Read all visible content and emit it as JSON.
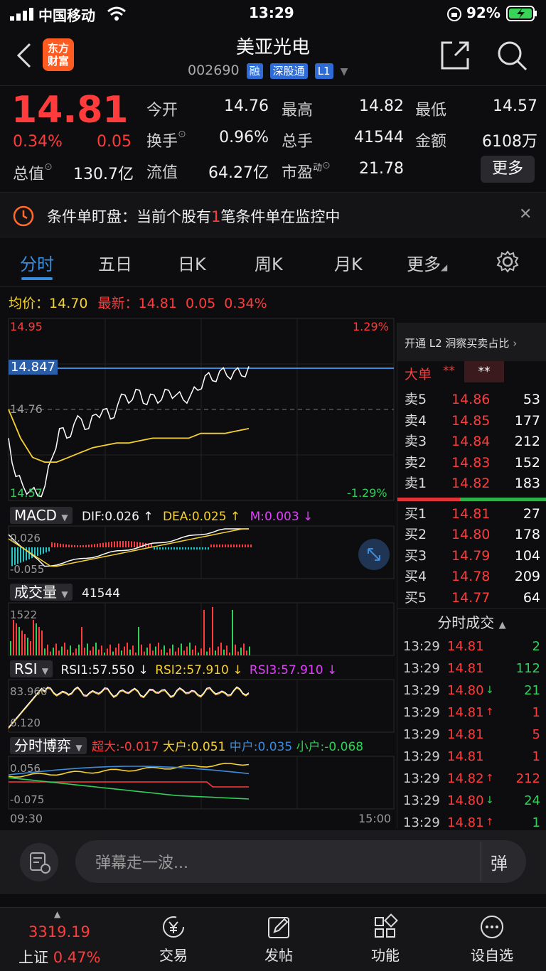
{
  "status_bar": {
    "carrier": "中国移动",
    "time": "13:29",
    "battery": "92%"
  },
  "header": {
    "logo_line1": "东方",
    "logo_line2": "财富",
    "stock_name": "美亚光电",
    "stock_code": "002690",
    "tags": [
      "融",
      "深股通",
      "L1"
    ]
  },
  "quote": {
    "price": "14.81",
    "change_pct": "0.34%",
    "change_amt": "0.05",
    "mkt_cap_label": "总值",
    "mkt_cap": "130.7亿",
    "open_label": "今开",
    "open": "14.76",
    "high_label": "最高",
    "high": "14.82",
    "low_label": "最低",
    "low": "14.57",
    "turnover_label": "换手",
    "turnover": "0.96%",
    "volume_label": "总手",
    "volume": "41544",
    "amount_label": "金额",
    "amount": "6108万",
    "float_label": "流值",
    "float_cap": "64.27亿",
    "pe_label": "市盈",
    "pe_sup": "动",
    "pe": "21.78",
    "more_button": "更多"
  },
  "notice": {
    "prefix": "条件单盯盘：当前个股有",
    "count": "1",
    "suffix": "笔条件单在监控中"
  },
  "tabs": [
    "分时",
    "五日",
    "日K",
    "周K",
    "月K",
    "更多"
  ],
  "chart_header": {
    "avg_label": "均价：",
    "avg": "14.70",
    "latest_label": "最新：",
    "latest": "14.81",
    "chg": "0.05",
    "pct": "0.34%"
  },
  "chart_data": {
    "type": "line",
    "price_axis": {
      "top": "14.95",
      "ref": "14.76",
      "bottom": "14.57",
      "top_pct": "1.29%",
      "bottom_pct": "-1.29%",
      "marker": "14.847"
    },
    "x_start": "09:30",
    "x_end": "15:00",
    "price_series": [
      14.7,
      14.62,
      14.6,
      14.59,
      14.58,
      14.6,
      14.66,
      14.72,
      14.7,
      14.73,
      14.74,
      14.72,
      14.75,
      14.76,
      14.74,
      14.77,
      14.79,
      14.78,
      14.8,
      14.77,
      14.79,
      14.78,
      14.8,
      14.79,
      14.78,
      14.79,
      14.8,
      14.83,
      14.82,
      14.84,
      14.83,
      14.84,
      14.83,
      14.85
    ],
    "avg_series": [
      14.76,
      14.7,
      14.66,
      14.65,
      14.65,
      14.66,
      14.67,
      14.68,
      14.685,
      14.69,
      14.69,
      14.695,
      14.7,
      14.7,
      14.7,
      14.7,
      14.71,
      14.71,
      14.71,
      14.715,
      14.72
    ]
  },
  "macd": {
    "title": "MACD",
    "dif": "DIF:0.026 ↑",
    "dea": "DEA:0.025 ↑",
    "m": "M:0.003 ↓",
    "top": "0.026",
    "bottom": "-0.055"
  },
  "volume": {
    "title": "成交量",
    "value": "41544",
    "max": "1522"
  },
  "rsi": {
    "title": "RSI",
    "rsi1": "RSI1:57.550 ↓",
    "rsi2": "RSI2:57.910 ↓",
    "rsi3": "RSI3:57.910 ↓",
    "top": "83.960",
    "bottom": "6.120"
  },
  "game": {
    "title": "分时博弈",
    "super": "超大:-0.017",
    "large": "大户:0.051",
    "mid": "中户:0.035",
    "small": "小户:-0.068",
    "top": "0.056",
    "bottom": "-0.075"
  },
  "orderbook": {
    "banner": "开通 L2 洞察买卖占比",
    "big_label": "大单",
    "stars": "**",
    "asks": [
      {
        "label": "卖5",
        "price": "14.86",
        "vol": "53"
      },
      {
        "label": "卖4",
        "price": "14.85",
        "vol": "177"
      },
      {
        "label": "卖3",
        "price": "14.84",
        "vol": "212"
      },
      {
        "label": "卖2",
        "price": "14.83",
        "vol": "152"
      },
      {
        "label": "卖1",
        "price": "14.82",
        "vol": "183"
      }
    ],
    "bids": [
      {
        "label": "买1",
        "price": "14.81",
        "vol": "27"
      },
      {
        "label": "买2",
        "price": "14.80",
        "vol": "178"
      },
      {
        "label": "买3",
        "price": "14.79",
        "vol": "104"
      },
      {
        "label": "买4",
        "price": "14.78",
        "vol": "209"
      },
      {
        "label": "买5",
        "price": "14.77",
        "vol": "64"
      }
    ]
  },
  "trades": {
    "title": "分时成交",
    "rows": [
      {
        "time": "13:29",
        "price": "14.81",
        "arrow": "",
        "vol": "2",
        "color": "green"
      },
      {
        "time": "13:29",
        "price": "14.81",
        "arrow": "",
        "vol": "112",
        "color": "green"
      },
      {
        "time": "13:29",
        "price": "14.80",
        "arrow": "↓",
        "vol": "21",
        "color": "green"
      },
      {
        "time": "13:29",
        "price": "14.81",
        "arrow": "↑",
        "vol": "1",
        "color": "red"
      },
      {
        "time": "13:29",
        "price": "14.81",
        "arrow": "",
        "vol": "5",
        "color": "red"
      },
      {
        "time": "13:29",
        "price": "14.81",
        "arrow": "",
        "vol": "1",
        "color": "red"
      },
      {
        "time": "13:29",
        "price": "14.82",
        "arrow": "↑",
        "vol": "212",
        "color": "red"
      },
      {
        "time": "13:29",
        "price": "14.80",
        "arrow": "↓",
        "vol": "24",
        "color": "green"
      },
      {
        "time": "13:29",
        "price": "14.81",
        "arrow": "↑",
        "vol": "1",
        "color": "green"
      }
    ]
  },
  "comment": {
    "placeholder": "弹幕走一波...",
    "danmu": "弹"
  },
  "bottom": {
    "index_value": "3319.19",
    "index_name": "上证",
    "index_pct": "0.47%",
    "items": [
      "交易",
      "发帖",
      "功能",
      "设自选"
    ]
  }
}
